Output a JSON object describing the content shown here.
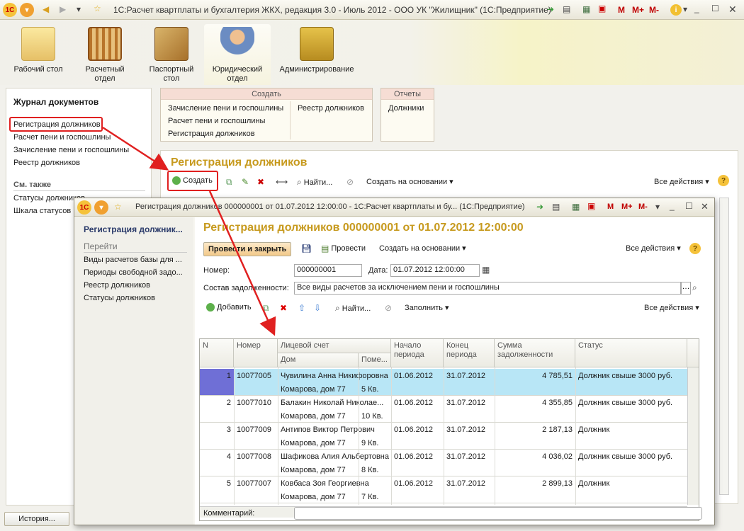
{
  "app": {
    "title": "1С:Расчет квартплаты и бухгалтерия ЖКХ, редакция 3.0 - Июль 2012 - ООО УК \"Жилищник\"  (1С:Предприятие)",
    "m_buttons": [
      "M",
      "M+",
      "M-"
    ]
  },
  "sections": [
    {
      "label": "Рабочий стол",
      "icon": "desk-icon"
    },
    {
      "label": "Расчетный отдел",
      "icon": "abacus-icon"
    },
    {
      "label": "Паспортный стол",
      "icon": "folder-icon"
    },
    {
      "label": "Юридический отдел",
      "icon": "lawyer-icon"
    },
    {
      "label": "Администрирование",
      "icon": "admin-icon"
    }
  ],
  "left_panel": {
    "title": "Журнал документов",
    "links": [
      "Регистрация должников",
      "Расчет пени и госпошлины",
      "Зачисление пени и госпошлины",
      "Реестр должников"
    ],
    "see_also": "См. также",
    "see_also_links": [
      "Статусы должников",
      "Шкала статусов"
    ],
    "history": "История..."
  },
  "create_box": {
    "header": "Создать",
    "col1": [
      "Зачисление пени и госпошлины",
      "Расчет пени и госпошлины",
      "Регистрация должников"
    ],
    "col2": [
      "Реестр должников"
    ]
  },
  "reports_box": {
    "header": "Отчеты",
    "items": [
      "Должники"
    ]
  },
  "journal": {
    "title": "Регистрация должников",
    "create": "Создать",
    "find": "Найти...",
    "create_based": "Создать на основании",
    "all_actions": "Все действия"
  },
  "doc": {
    "window_title": "Регистрация должников 000000001 от 01.07.2012 12:00:00 - 1С:Расчет квартплаты и бу...  (1С:Предприятие)",
    "left_title": "Регистрация должник...",
    "nav_header": "Перейти",
    "nav_links": [
      "Виды расчетов базы для ...",
      "Периоды свободной задо...",
      "Реестр должников",
      "Статусы должников"
    ],
    "heading": "Регистрация должников 000000001 от 01.07.2012 12:00:00",
    "post_close": "Провести и закрыть",
    "post": "Провести",
    "create_based": "Создать на основании",
    "all_actions": "Все действия",
    "number_label": "Номер:",
    "number": "000000001",
    "date_label": "Дата:",
    "date": "01.07.2012 12:00:00",
    "debt_label": "Состав задолженности:",
    "debt_value": "Все виды расчетов за исключением пени и госпошлины",
    "add": "Добавить",
    "find": "Найти...",
    "fill": "Заполнить",
    "table_all_actions": "Все действия",
    "comment_label": "Комментарий:",
    "comment": ""
  },
  "table": {
    "headers": {
      "n": "N",
      "number": "Номер",
      "account": "Лицевой счет",
      "house": "Дом",
      "apt": "Поме...",
      "start": "Начало периода",
      "end": "Конец периода",
      "sum": "Сумма задолженности",
      "status": "Статус"
    },
    "rows": [
      {
        "n": "1",
        "number": "10077005",
        "name": "Чувилина Анна Никифоровна",
        "house": "Комарова, дом 77",
        "apt": "5 Кв.",
        "start": "01.06.2012",
        "end": "31.07.2012",
        "sum": "4 785,51",
        "status": "Должник свыше 3000 руб."
      },
      {
        "n": "2",
        "number": "10077010",
        "name": "Балакин Николай Николае...",
        "house": "Комарова, дом 77",
        "apt": "10 Кв.",
        "start": "01.06.2012",
        "end": "31.07.2012",
        "sum": "4 355,85",
        "status": "Должник свыше 3000 руб."
      },
      {
        "n": "3",
        "number": "10077009",
        "name": "Антипов Виктор Петрович",
        "house": "Комарова, дом 77",
        "apt": "9 Кв.",
        "start": "01.06.2012",
        "end": "31.07.2012",
        "sum": "2 187,13",
        "status": "Должник"
      },
      {
        "n": "4",
        "number": "10077008",
        "name": "Шафикова Алия Альбертовна",
        "house": "Комарова, дом 77",
        "apt": "8 Кв.",
        "start": "01.06.2012",
        "end": "31.07.2012",
        "sum": "4 036,02",
        "status": "Должник свыше 3000 руб."
      },
      {
        "n": "5",
        "number": "10077007",
        "name": "Ковбаса Зоя Георгиевна",
        "house": "Комарова, дом 77",
        "apt": "7 Кв.",
        "start": "01.06.2012",
        "end": "31.07.2012",
        "sum": "2 899,13",
        "status": "Должник"
      }
    ]
  },
  "colors": {
    "accent": "#c79a1e",
    "highlight": "#e02020",
    "selected_row": "#b8e6f6"
  }
}
